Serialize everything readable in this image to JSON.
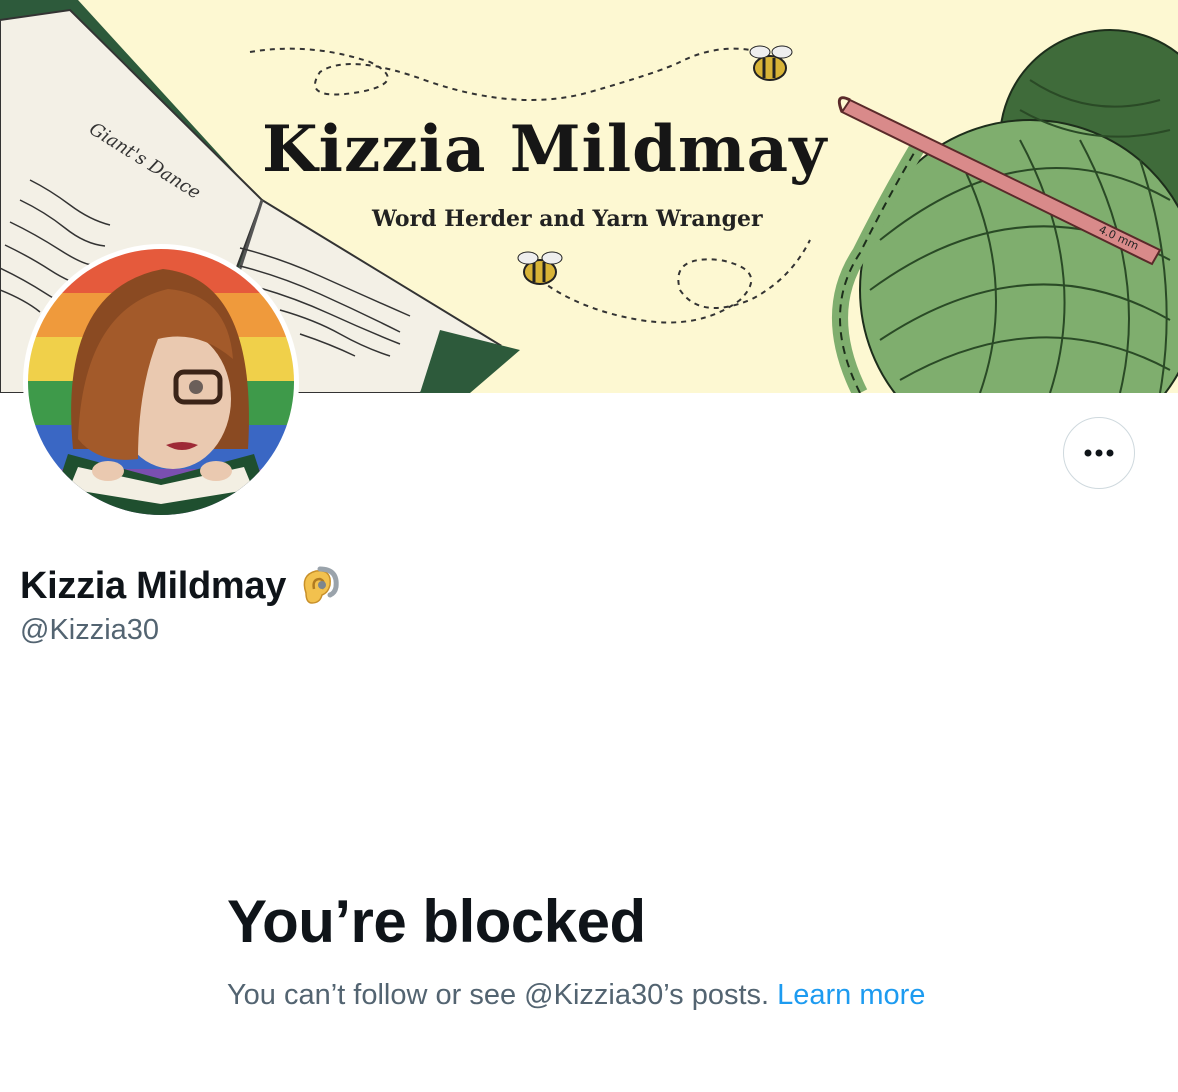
{
  "banner": {
    "title": "Kizzia Mildmay",
    "subtitle": "Word Herder and Yarn Wranger",
    "book_heading": "Giant's Dance",
    "hook_label": "4.0 mm"
  },
  "profile": {
    "display_name": "Kizzia Mildmay",
    "name_icon": "ear-with-hearing-aid-icon",
    "handle": "@Kizzia30",
    "more_button_label": "More"
  },
  "blocked": {
    "title": "You’re blocked",
    "message": "You can’t follow or see @Kizzia30’s posts. ",
    "link_label": "Learn more"
  },
  "colors": {
    "banner_background": "#fdf8d2",
    "yarn_green": "#7fae6e",
    "yarn_dark": "#3f6b3a",
    "hook_pink": "#d98a8a",
    "secondary_text": "#536471",
    "link": "#1d9bf0",
    "primary_text": "#0f1419"
  }
}
